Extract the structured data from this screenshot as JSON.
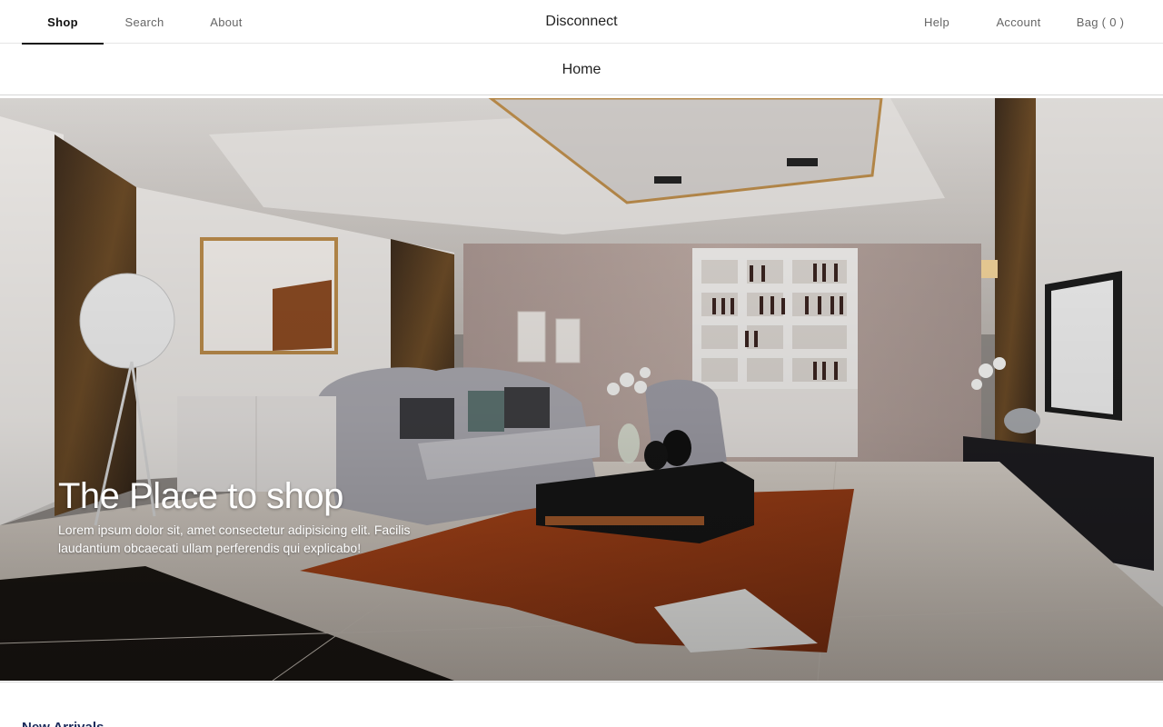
{
  "nav": {
    "left": [
      {
        "label": "Shop",
        "active": true
      },
      {
        "label": "Search",
        "active": false
      },
      {
        "label": "About",
        "active": false
      }
    ],
    "brand": "Disconnect",
    "right": [
      {
        "label": "Help"
      },
      {
        "label": "Account"
      },
      {
        "label": "Bag ( 0 )"
      }
    ]
  },
  "subheader": {
    "title": "Home"
  },
  "hero": {
    "title": "The Place to shop",
    "text": "Lorem ipsum dolor sit, amet consectetur adipisicing elit. Facilis laudantium obcaecati ullam perferendis qui explicabo!"
  },
  "section": {
    "title": "New Arrivals"
  }
}
